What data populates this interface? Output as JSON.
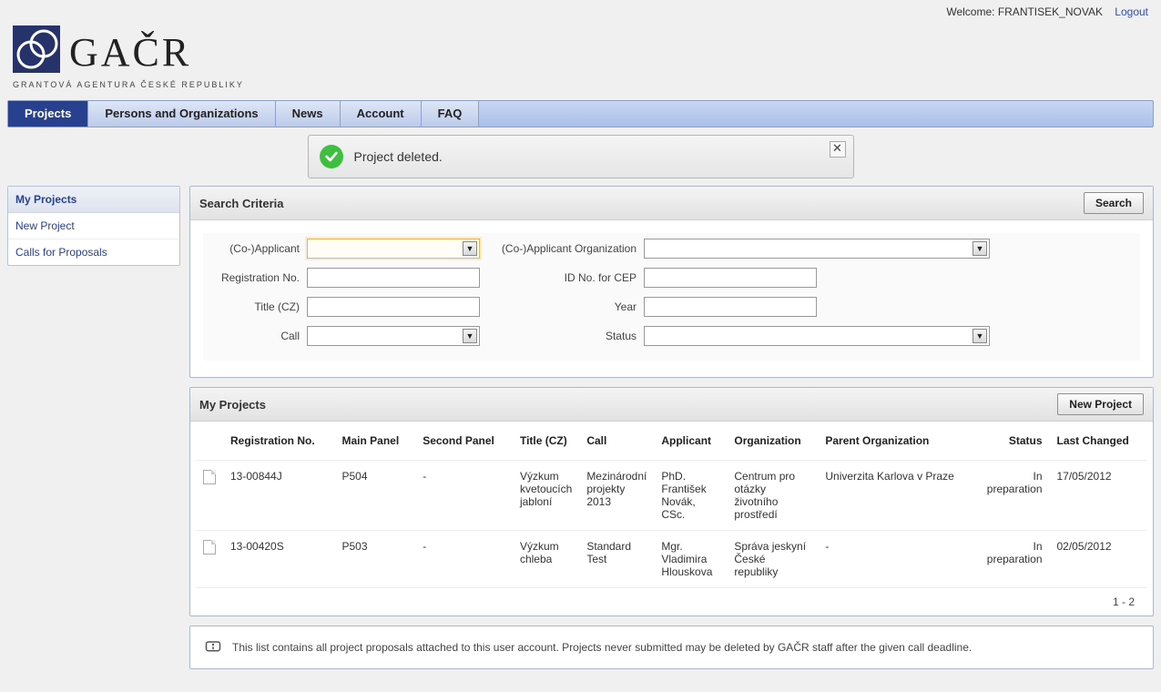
{
  "topbar": {
    "welcome_prefix": "Welcome: ",
    "username": "FRANTISEK_NOVAK",
    "logout": "Logout"
  },
  "logo": {
    "title": "GAČR",
    "subtitle": "GRANTOVÁ AGENTURA ČESKÉ REPUBLIKY"
  },
  "nav": {
    "projects": "Projects",
    "persons": "Persons and Organizations",
    "news": "News",
    "account": "Account",
    "faq": "FAQ"
  },
  "notice": {
    "message": "Project deleted."
  },
  "sidebar": {
    "header": "My Projects",
    "links": [
      "New Project",
      "Calls for Proposals"
    ]
  },
  "search_panel": {
    "title": "Search Criteria",
    "search_btn": "Search",
    "labels": {
      "coapplicant": "(Co-)Applicant",
      "coapplicant_org": "(Co-)Applicant Organization",
      "reg_no": "Registration No.",
      "id_cep": "ID No. for CEP",
      "title_cz": "Title (CZ)",
      "year": "Year",
      "call": "Call",
      "status": "Status"
    },
    "values": {
      "coapplicant": "",
      "coapplicant_org": "",
      "reg_no": "",
      "id_cep": "",
      "title_cz": "",
      "year": "",
      "call": "",
      "status": ""
    }
  },
  "projects_panel": {
    "title": "My Projects",
    "new_btn": "New Project",
    "columns": {
      "reg_no": "Registration No.",
      "main_panel": "Main Panel",
      "second_panel": "Second Panel",
      "title_cz": "Title (CZ)",
      "call": "Call",
      "applicant": "Applicant",
      "organization": "Organization",
      "parent_org": "Parent Organization",
      "status": "Status",
      "last_changed": "Last Changed"
    },
    "rows": [
      {
        "reg_no": "13-00844J",
        "main_panel": "P504",
        "second_panel": "-",
        "title_cz": "Výzkum kvetoucích jabloní",
        "call": "Mezinárodní projekty 2013",
        "applicant": "PhD. František Novák, CSc.",
        "organization": "Centrum pro otázky životního prostředí",
        "parent_org": "Univerzita Karlova v Praze",
        "status": "In preparation",
        "last_changed": "17/05/2012"
      },
      {
        "reg_no": "13-00420S",
        "main_panel": "P503",
        "second_panel": "-",
        "title_cz": "Výzkum chleba",
        "call": "Standard Test",
        "applicant": "Mgr. Vladimira Hlouskova",
        "organization": "Správa jeskyní České republiky",
        "parent_org": "-",
        "status": "In preparation",
        "last_changed": "02/05/2012"
      }
    ],
    "pager": "1 - 2"
  },
  "info": {
    "text": "This list contains all project proposals attached to this user account. Projects never submitted may be deleted by GAČR staff after the given call deadline."
  }
}
